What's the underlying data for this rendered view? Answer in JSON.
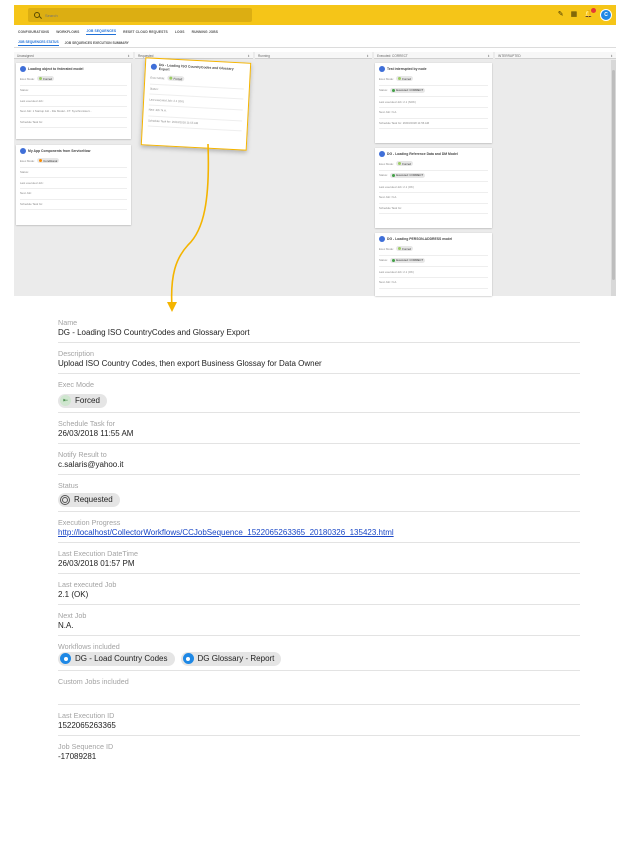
{
  "topbar": {
    "search_placeholder": "Search"
  },
  "nav": {
    "tabs": [
      "CONFIGURATIONS",
      "WORKFLOWS",
      "JOB SEQUENCES",
      "RESET CLOUD REQUESTS",
      "LOGS",
      "RUNNING JOBS"
    ],
    "active": "JOB SEQUENCES"
  },
  "subnav": {
    "tabs": [
      "JOB SEQUENCES STATUS",
      "JOB SEQUENCES EXECUTION SUMMARY"
    ],
    "active": "JOB SEQUENCES STATUS"
  },
  "board": {
    "columns": [
      {
        "title": "Unassigned"
      },
      {
        "title": "Requested"
      },
      {
        "title": "Running"
      },
      {
        "title": "Executed: CORRECT"
      },
      {
        "title": "INTERRUPTED"
      }
    ],
    "cards": {
      "unassigned_1": {
        "title": "Loading object to federated model",
        "exec_label": "Exec Mode:",
        "exec_value": "Forced",
        "status_label": "Status:",
        "last_job": "Last executed Job:",
        "next_job": "Next Job: 1 Startup Job - File Model - FT: Synchronisiert...",
        "schedule": "Schedule Task for:"
      },
      "unassigned_2": {
        "title": "My App Components from ServiceNow",
        "exec_label": "Exec Mode:",
        "exec_value": "Conditional",
        "status_label": "Status:",
        "last_job": "Last executed Job:",
        "next_job": "Next Job:",
        "schedule": "Schedule Task for:"
      },
      "requested_1": {
        "title": "DG - Loading ISO CountryCodes and Glossary Export",
        "exec_label": "Exec Mode:",
        "exec_value": "Forced",
        "status_label": "Status:",
        "last_job": "Last executed Job: 2.1 (OK)",
        "next_job": "Next Job: N.A.",
        "schedule": "Schedule Task for: 26/03/2018 11:55 AM"
      },
      "executed_1": {
        "title": "Test interrupted by node",
        "exec_label": "Exec Mode:",
        "exec_value": "Forced",
        "status_label": "Status:",
        "status_value": "Executed: CORRECT",
        "last_job": "Last executed Job: 2.1 (NOK)",
        "next_job": "Next Job: N.A.",
        "schedule": "Schedule Task for: 26/03/2018 11:56 AM"
      },
      "executed_2": {
        "title": "DG - Loading Reference Data and DM Model",
        "exec_label": "Exec Mode:",
        "exec_value": "Forced",
        "status_label": "Status:",
        "status_value": "Executed: CORRECT",
        "last_job": "Last executed Job: 2.1 (OK)",
        "next_job": "Next Job: N.A.",
        "schedule": "Schedule Task for:"
      },
      "executed_3": {
        "title": "DG - Loading PERSON-ADDRESS model",
        "exec_label": "Exec Mode:",
        "exec_value": "Forced",
        "status_label": "Status:",
        "status_value": "Executed: CORRECT",
        "last_job": "Last executed Job: 2.1 (OK)",
        "next_job": "Next Job: N.A."
      }
    }
  },
  "detail": {
    "name_label": "Name",
    "name": "DG - Loading ISO CountryCodes and Glossary Export",
    "description_label": "Description",
    "description": "Upload ISO Country Codes, then export Business Glossay for Data Owner",
    "exec_mode_label": "Exec Mode",
    "exec_mode": "Forced",
    "schedule_label": "Schedule Task for",
    "schedule": "26/03/2018 11:55 AM",
    "notify_label": "Notify Result to",
    "notify": "c.salaris@yahoo.it",
    "status_label": "Status",
    "status": "Requested",
    "progress_label": "Execution Progress",
    "progress_url": "http://localhost/CollectorWorkflows/CCJobSequence_1522065263365_20180326_135423.html",
    "last_exec_label": "Last Execution DateTime",
    "last_exec": "26/03/2018 01:57 PM",
    "last_job_label": "Last executed Job",
    "last_job": "2.1 (OK)",
    "next_job_label": "Next Job",
    "next_job": "N.A.",
    "workflows_label": "Workflows included",
    "workflows": [
      "DG - Load Country Codes",
      "DG Glossary - Report"
    ],
    "custom_jobs_label": "Custom Jobs included",
    "last_exec_id_label": "Last Execution ID",
    "last_exec_id": "1522065263365",
    "job_seq_id_label": "Job Sequence ID",
    "job_seq_id": "-17089281"
  },
  "colors": {
    "appbar": "#f5c518",
    "accent": "#1e6fd6",
    "highlight": "#f4b400"
  }
}
